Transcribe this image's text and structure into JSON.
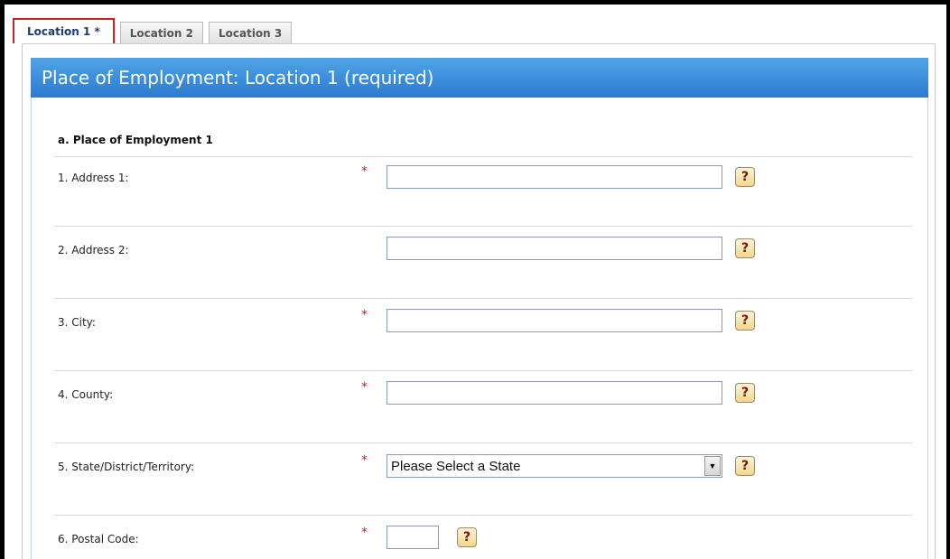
{
  "tabs": [
    {
      "label": "Location 1 *"
    },
    {
      "label": "Location 2"
    },
    {
      "label": "Location 3"
    }
  ],
  "panel": {
    "title": "Place of Employment: Location 1 (required)",
    "section_title": "a. Place of Employment 1"
  },
  "fields": {
    "address1": {
      "label": "1. Address 1:",
      "required_mark": "*",
      "value": ""
    },
    "address2": {
      "label": "2. Address 2:",
      "value": ""
    },
    "city": {
      "label": "3. City:",
      "required_mark": "*",
      "value": ""
    },
    "county": {
      "label": "4. County:",
      "required_mark": "*",
      "value": ""
    },
    "state": {
      "label": "5. State/District/Territory:",
      "required_mark": "*",
      "selected": "Please Select a State"
    },
    "postal": {
      "label": "6. Postal Code:",
      "required_mark": "*",
      "value": ""
    }
  },
  "help_glyph": "?",
  "colors": {
    "header_blue": "#2b7ad0",
    "required_red": "#cc2222",
    "active_tab_outline": "#cc2222"
  }
}
